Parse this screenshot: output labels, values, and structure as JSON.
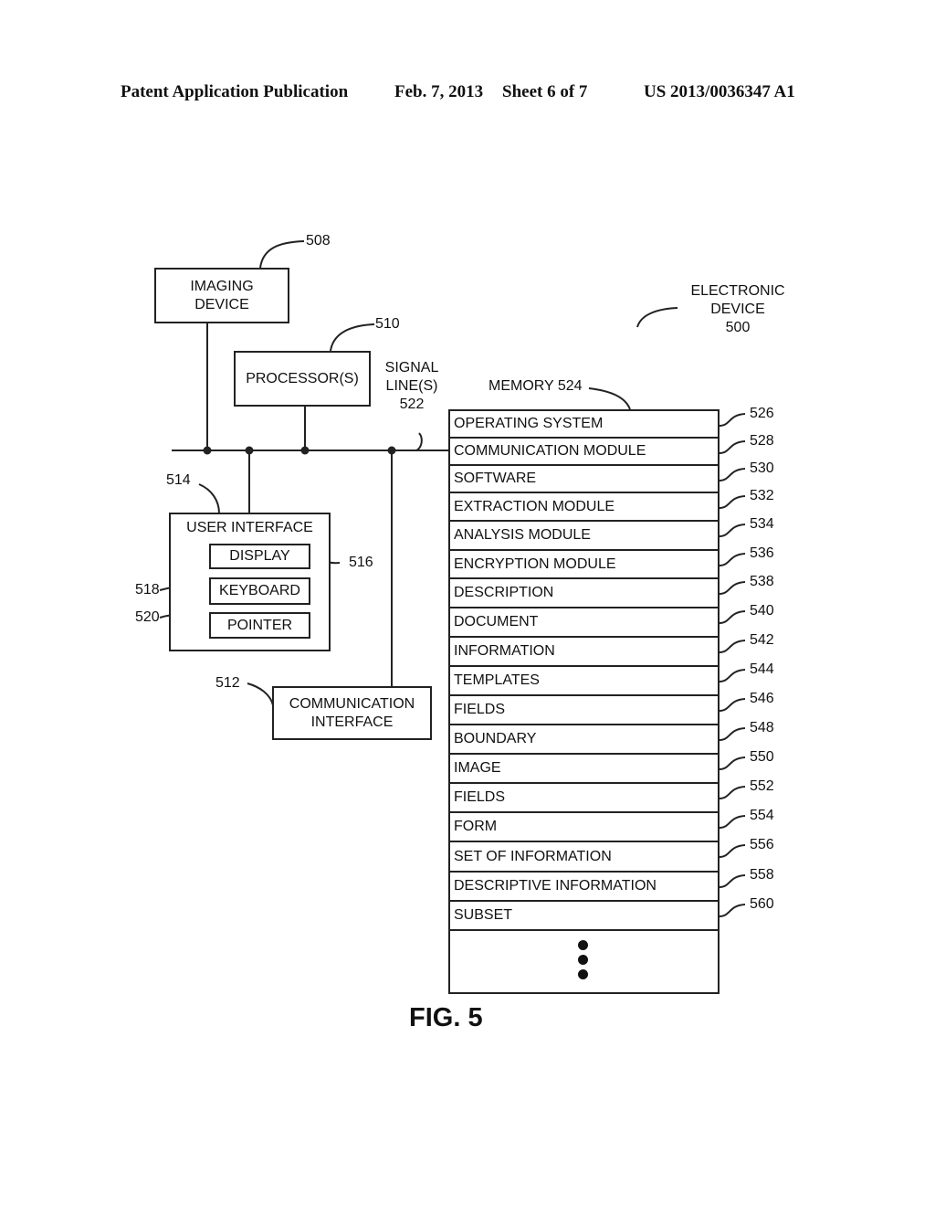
{
  "header": {
    "publication": "Patent Application Publication",
    "date": "Feb. 7, 2013",
    "sheet": "Sheet 6 of 7",
    "number": "US 2013/0036347 A1"
  },
  "device": {
    "line1": "ELECTRONIC",
    "line2": "DEVICE",
    "ref": "500"
  },
  "imaging": {
    "line1": "IMAGING",
    "line2": "DEVICE",
    "ref": "508"
  },
  "processor": {
    "label": "PROCESSOR(S)",
    "ref": "510"
  },
  "signal": {
    "line1": "SIGNAL",
    "line2": "LINE(S)",
    "ref": "522"
  },
  "user_interface": {
    "label": "USER INTERFACE",
    "ref": "514",
    "display": {
      "label": "DISPLAY",
      "ref": "516"
    },
    "keyboard": {
      "label": "KEYBOARD",
      "ref": "518"
    },
    "pointer": {
      "label": "POINTER",
      "ref": "520"
    }
  },
  "comm_interface": {
    "line1": "COMMUNICATION",
    "line2": "INTERFACE",
    "ref": "512"
  },
  "memory": {
    "label": "MEMORY 524",
    "rows": [
      {
        "label": "OPERATING SYSTEM",
        "ref": "526"
      },
      {
        "label": "COMMUNICATION MODULE",
        "ref": "528"
      },
      {
        "label": "SOFTWARE",
        "ref": "530"
      },
      {
        "label": "EXTRACTION MODULE",
        "ref": "532"
      },
      {
        "label": "ANALYSIS MODULE",
        "ref": "534"
      },
      {
        "label": "ENCRYPTION MODULE",
        "ref": "536"
      },
      {
        "label": "DESCRIPTION",
        "ref": "538"
      },
      {
        "label": "DOCUMENT",
        "ref": "540"
      },
      {
        "label": "INFORMATION",
        "ref": "542"
      },
      {
        "label": "TEMPLATES",
        "ref": "544"
      },
      {
        "label": "FIELDS",
        "ref": "546"
      },
      {
        "label": "BOUNDARY",
        "ref": "548"
      },
      {
        "label": "IMAGE",
        "ref": "550"
      },
      {
        "label": "FIELDS",
        "ref": "552"
      },
      {
        "label": "FORM",
        "ref": "554"
      },
      {
        "label": "SET OF INFORMATION",
        "ref": "556"
      },
      {
        "label": "DESCRIPTIVE INFORMATION",
        "ref": "558"
      },
      {
        "label": "SUBSET",
        "ref": "560"
      }
    ]
  },
  "figure_label": "FIG. 5"
}
